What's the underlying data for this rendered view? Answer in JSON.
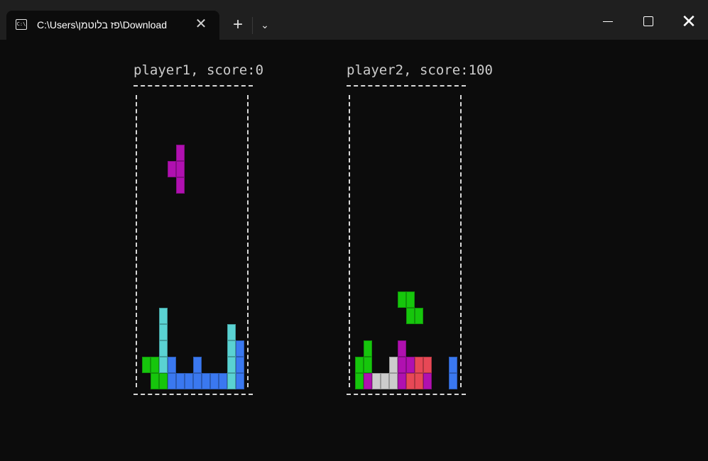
{
  "window": {
    "tab_title": "C:\\Users\\פז בלוטמן\\Download",
    "tab_icon": "terminal-icon",
    "new_tab_icon": "plus-icon",
    "dropdown_icon": "chevron-down-icon",
    "close_tab_icon": "close-icon",
    "buttons": [
      "minimize-icon",
      "maximize-icon",
      "close-icon"
    ]
  },
  "players": [
    {
      "label": "player1, score:0"
    },
    {
      "label": "player2, score:100"
    }
  ],
  "colors": {
    "magenta": "#b010b0",
    "cyan": "#5ad2d2",
    "blue": "#3a78f0",
    "green": "#16c60c",
    "gray": "#cccccc",
    "red": "#e74856"
  },
  "boards": [
    {
      "name": "board-player1",
      "cells": [
        {
          "c": 4,
          "r": 3,
          "k": "magenta"
        },
        {
          "c": 3,
          "r": 4,
          "k": "magenta"
        },
        {
          "c": 4,
          "r": 4,
          "k": "magenta"
        },
        {
          "c": 4,
          "r": 5,
          "k": "magenta"
        },
        {
          "c": 2,
          "r": 13,
          "k": "cyan"
        },
        {
          "c": 2,
          "r": 14,
          "k": "cyan"
        },
        {
          "c": 2,
          "r": 15,
          "k": "cyan"
        },
        {
          "c": 2,
          "r": 16,
          "k": "cyan"
        },
        {
          "c": 10,
          "r": 14,
          "k": "cyan"
        },
        {
          "c": 10,
          "r": 15,
          "k": "cyan"
        },
        {
          "c": 10,
          "r": 16,
          "k": "cyan"
        },
        {
          "c": 10,
          "r": 17,
          "k": "cyan"
        },
        {
          "c": 11,
          "r": 15,
          "k": "blue"
        },
        {
          "c": 11,
          "r": 16,
          "k": "blue"
        },
        {
          "c": 11,
          "r": 17,
          "k": "blue"
        },
        {
          "c": 0,
          "r": 16,
          "k": "green"
        },
        {
          "c": 1,
          "r": 16,
          "k": "green"
        },
        {
          "c": 1,
          "r": 17,
          "k": "green"
        },
        {
          "c": 2,
          "r": 17,
          "k": "green"
        },
        {
          "c": 3,
          "r": 16,
          "k": "blue"
        },
        {
          "c": 3,
          "r": 17,
          "k": "blue"
        },
        {
          "c": 4,
          "r": 17,
          "k": "blue"
        },
        {
          "c": 5,
          "r": 17,
          "k": "blue"
        },
        {
          "c": 6,
          "r": 16,
          "k": "blue"
        },
        {
          "c": 6,
          "r": 17,
          "k": "blue"
        },
        {
          "c": 7,
          "r": 17,
          "k": "blue"
        },
        {
          "c": 8,
          "r": 17,
          "k": "blue"
        },
        {
          "c": 9,
          "r": 17,
          "k": "blue"
        }
      ]
    },
    {
      "name": "board-player2",
      "cells": [
        {
          "c": 5,
          "r": 12,
          "k": "green"
        },
        {
          "c": 6,
          "r": 12,
          "k": "green"
        },
        {
          "c": 6,
          "r": 13,
          "k": "green"
        },
        {
          "c": 7,
          "r": 13,
          "k": "green"
        },
        {
          "c": 1,
          "r": 15,
          "k": "green"
        },
        {
          "c": 0,
          "r": 16,
          "k": "green"
        },
        {
          "c": 1,
          "r": 16,
          "k": "green"
        },
        {
          "c": 0,
          "r": 17,
          "k": "green"
        },
        {
          "c": 1,
          "r": 17,
          "k": "magenta"
        },
        {
          "c": 2,
          "r": 17,
          "k": "gray"
        },
        {
          "c": 3,
          "r": 17,
          "k": "gray"
        },
        {
          "c": 4,
          "r": 16,
          "k": "gray"
        },
        {
          "c": 4,
          "r": 17,
          "k": "gray"
        },
        {
          "c": 5,
          "r": 15,
          "k": "magenta"
        },
        {
          "c": 5,
          "r": 16,
          "k": "magenta"
        },
        {
          "c": 6,
          "r": 16,
          "k": "magenta"
        },
        {
          "c": 5,
          "r": 17,
          "k": "magenta"
        },
        {
          "c": 7,
          "r": 16,
          "k": "red"
        },
        {
          "c": 8,
          "r": 16,
          "k": "red"
        },
        {
          "c": 6,
          "r": 17,
          "k": "red"
        },
        {
          "c": 7,
          "r": 17,
          "k": "red"
        },
        {
          "c": 8,
          "r": 17,
          "k": "magenta"
        },
        {
          "c": 11,
          "r": 16,
          "k": "blue"
        },
        {
          "c": 11,
          "r": 17,
          "k": "blue"
        }
      ]
    }
  ]
}
